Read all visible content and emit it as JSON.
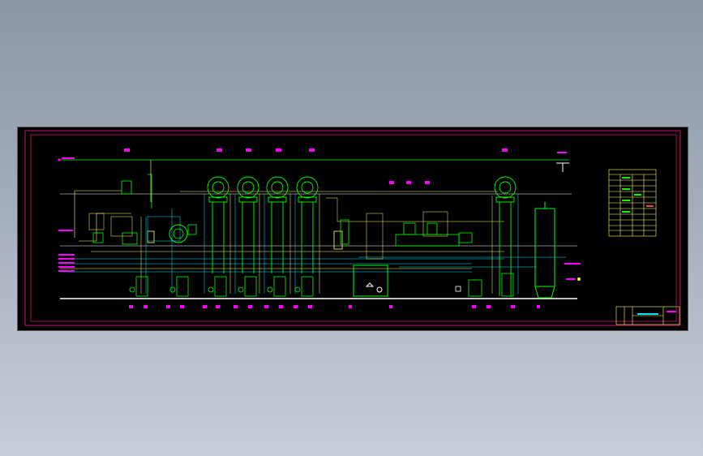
{
  "viewer": {
    "background_top": "#8b97a7",
    "background_bottom": "#c8ced7"
  },
  "drawing": {
    "kind": "process flow schematic",
    "colors": {
      "paper": "#000000",
      "frame": "#d01070",
      "equipment": "#00ff00",
      "process_line": "#ffff66",
      "water_line": "#00e5ff",
      "tag": "#ff00ff",
      "header_line": "#ffffff",
      "steam_line": "#ff4040"
    },
    "components": {
      "top_header": "top-header-line",
      "evaporators": [
        "evaporator-1",
        "evaporator-2",
        "evaporator-3",
        "evaporator-4",
        "evaporator-5"
      ],
      "pump_sets": [
        "pump-set-1",
        "pump-set-2",
        "pump-set-3",
        "pump-set-4",
        "pump-set-5"
      ],
      "condenser": "condenser",
      "central_tank": "central-tank",
      "storage_column": "storage-column",
      "floor_line": "floor-line",
      "equipment_table": "equipment-table",
      "title_block": "title-block"
    }
  }
}
